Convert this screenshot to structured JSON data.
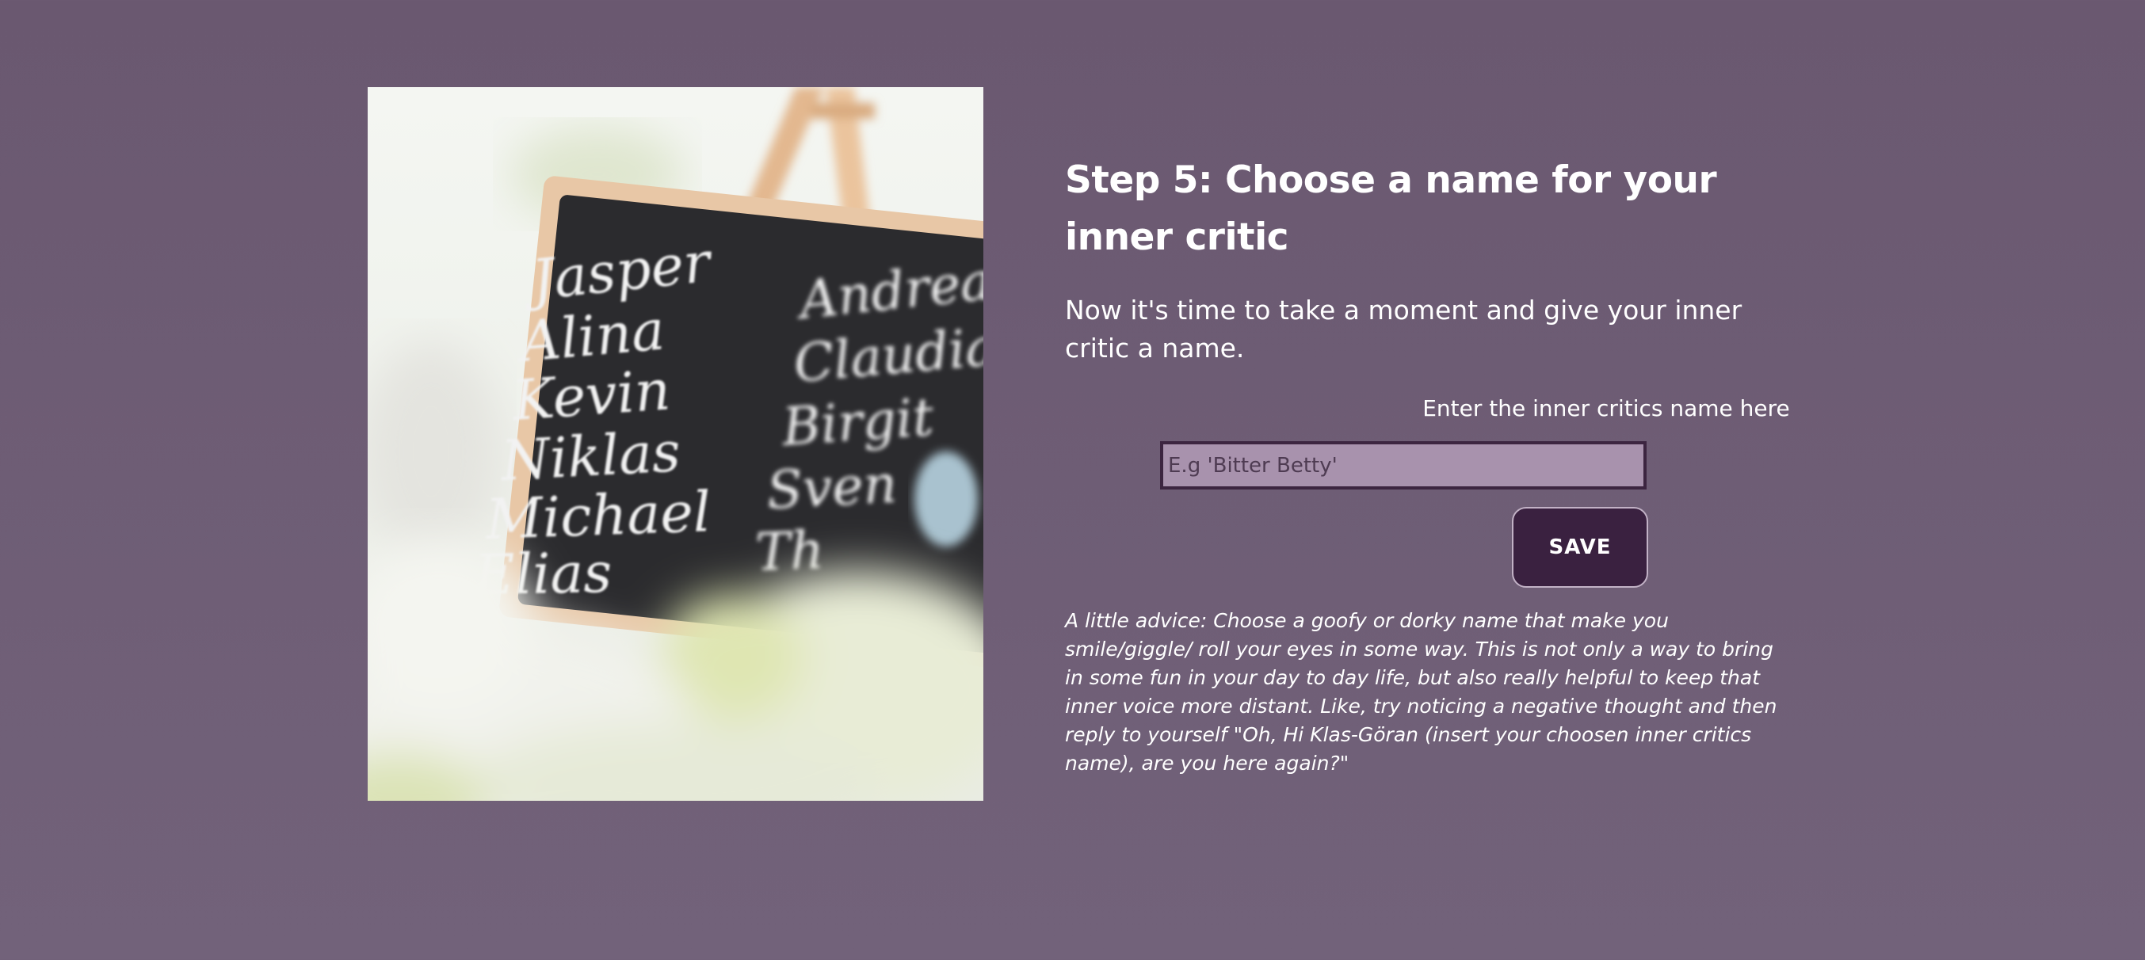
{
  "step": {
    "title": "Step 5: Choose a name for your inner critic",
    "intro": "Now it's time to take a moment and give your inner critic a name."
  },
  "form": {
    "label": "Enter the inner critics name here",
    "placeholder": "E.g 'Bitter Betty'",
    "value": "",
    "save_label": "SAVE"
  },
  "advice": "A little advice: Choose a goofy or dorky name that make you smile/giggle/ roll your eyes in some way. This is not only a way to bring in some fun in your day to day life, but also really helpful to keep that inner voice more distant. Like, try noticing a negative thought and then reply to yourself \"Oh, Hi Klas-Göran (insert your choosen inner critics name), are you here again?\"",
  "photo": {
    "names_left": [
      "Jasper",
      "Alina",
      "Kevin",
      "Niklas",
      "Michael",
      "Elias"
    ],
    "names_right": [
      "Andrea",
      "Claudia",
      "Birgit",
      "Sven",
      "Th"
    ]
  },
  "colors": {
    "background": "#6b5a72",
    "input_bg": "#a892ad",
    "button_bg": "#3a2140"
  }
}
